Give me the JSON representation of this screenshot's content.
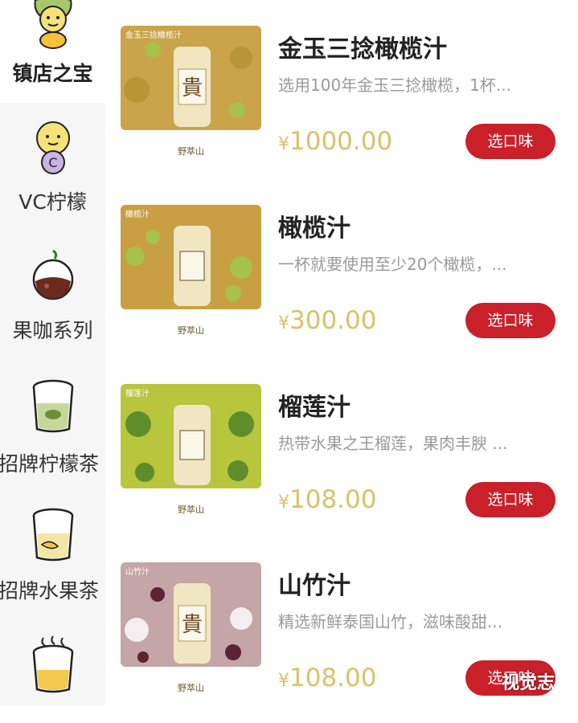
{
  "sidebar": {
    "items": [
      {
        "label": "镇店之宝",
        "icon": "mascot-lemon-icon",
        "active": true
      },
      {
        "label": "VC柠檬",
        "icon": "vc-lemon-mascot-icon",
        "active": false
      },
      {
        "label": "果咖系列",
        "icon": "fruit-coffee-icon",
        "active": false
      },
      {
        "label": "招牌柠檬茶",
        "icon": "lemon-tea-cup-icon",
        "active": false
      },
      {
        "label": "招牌水果茶",
        "icon": "fruit-tea-cup-icon",
        "active": false
      },
      {
        "label": "",
        "icon": "hot-drink-cup-icon",
        "active": false
      }
    ]
  },
  "products": [
    {
      "name": "金玉三捻橄榄汁",
      "desc": "选用100年金玉三捻橄榄，1杯...",
      "currency": "¥",
      "price": "1000.00",
      "button": "选口味",
      "thumb_label": "金玉三捻橄榄汁",
      "brand": "野萃山",
      "bg": "#c9a44a"
    },
    {
      "name": "橄榄汁",
      "desc": "一杯就要使用至少20个橄榄，...",
      "currency": "¥",
      "price": "300.00",
      "button": "选口味",
      "thumb_label": "橄榄汁",
      "brand": "野萃山",
      "bg": "#c8a043"
    },
    {
      "name": "榴莲汁",
      "desc": "热带水果之王榴莲，果肉丰腴 ...",
      "currency": "¥",
      "price": "108.00",
      "button": "选口味",
      "thumb_label": "榴莲汁",
      "brand": "野萃山",
      "bg": "#b7c63d"
    },
    {
      "name": "山竹汁",
      "desc": "精选新鲜泰国山竹，滋味酸甜...",
      "currency": "¥",
      "price": "108.00",
      "button": "选口味",
      "thumb_label": "山竹汁",
      "brand": "野萃山",
      "bg": "#c4a5a8"
    }
  ],
  "watermark": "视觉志"
}
